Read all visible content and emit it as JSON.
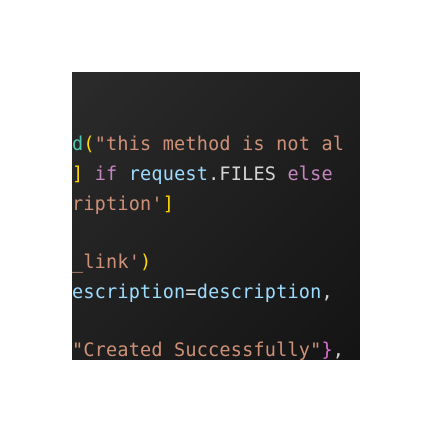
{
  "code": {
    "line1": {
      "fn": "d",
      "open_paren": "(",
      "string": "\"this method is not al"
    },
    "line2": {
      "bracket": "]",
      "space1": " ",
      "kw_if": "if",
      "space2": " ",
      "var_request": "request",
      "dot_files": ".FILES",
      "space3": " ",
      "kw_else": "else"
    },
    "line3": {
      "string": "ription'",
      "bracket": "]"
    },
    "line4": {
      "string": "_link'",
      "paren": ")"
    },
    "line5": {
      "var1": "escription",
      "eq": "=",
      "var2": "description",
      "comma": ","
    },
    "line6": {
      "string": "\"Created Successfully\"",
      "brace": "}",
      "comma": ","
    }
  }
}
